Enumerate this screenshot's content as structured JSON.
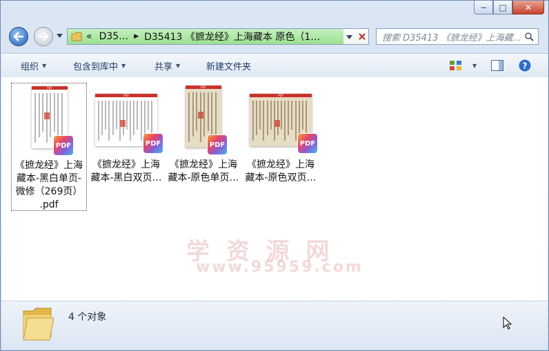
{
  "window": {
    "controls": {
      "minimize": "−",
      "maximize": "□",
      "close": "✕"
    }
  },
  "nav": {
    "back_icon": "back-arrow-icon",
    "forward_icon": "forward-arrow-icon",
    "path_overflow": "«",
    "path_segment_1": "D35…",
    "path_segment_2": "D35413 《摭龙经》上海藏本 原色（1…",
    "search_placeholder": "搜索 D35413 《摭龙经》上海藏..."
  },
  "toolbar": {
    "organize": "组织",
    "include_in_library": "包含到库中",
    "share": "共享",
    "new_folder": "新建文件夹"
  },
  "files": [
    {
      "name_lines": [
        "《摭龙经》上海",
        "藏本-黑白单页-",
        "微修（269页）",
        ".pdf"
      ],
      "selected": true,
      "thumb": "single",
      "tone": "bw"
    },
    {
      "name_lines": [
        "《摭龙经》上海",
        "藏本-黑白双页…"
      ],
      "selected": false,
      "thumb": "double",
      "tone": "bw"
    },
    {
      "name_lines": [
        "《摭龙经》上海",
        "藏本-原色单页…"
      ],
      "selected": false,
      "thumb": "single",
      "tone": "color"
    },
    {
      "name_lines": [
        "《摭龙经》上海",
        "藏本-原色双页…"
      ],
      "selected": false,
      "thumb": "double",
      "tone": "color"
    }
  ],
  "badge_text": "PDF",
  "thumb_header": "PDF",
  "watermark": {
    "line1": "学 资 源 网",
    "line2": "www.95959.com"
  },
  "status": {
    "count_text": "4 个对象"
  },
  "colors": {
    "accent": "#1e3d66",
    "address_fill": "#9be090",
    "close_red": "#c7452c"
  }
}
